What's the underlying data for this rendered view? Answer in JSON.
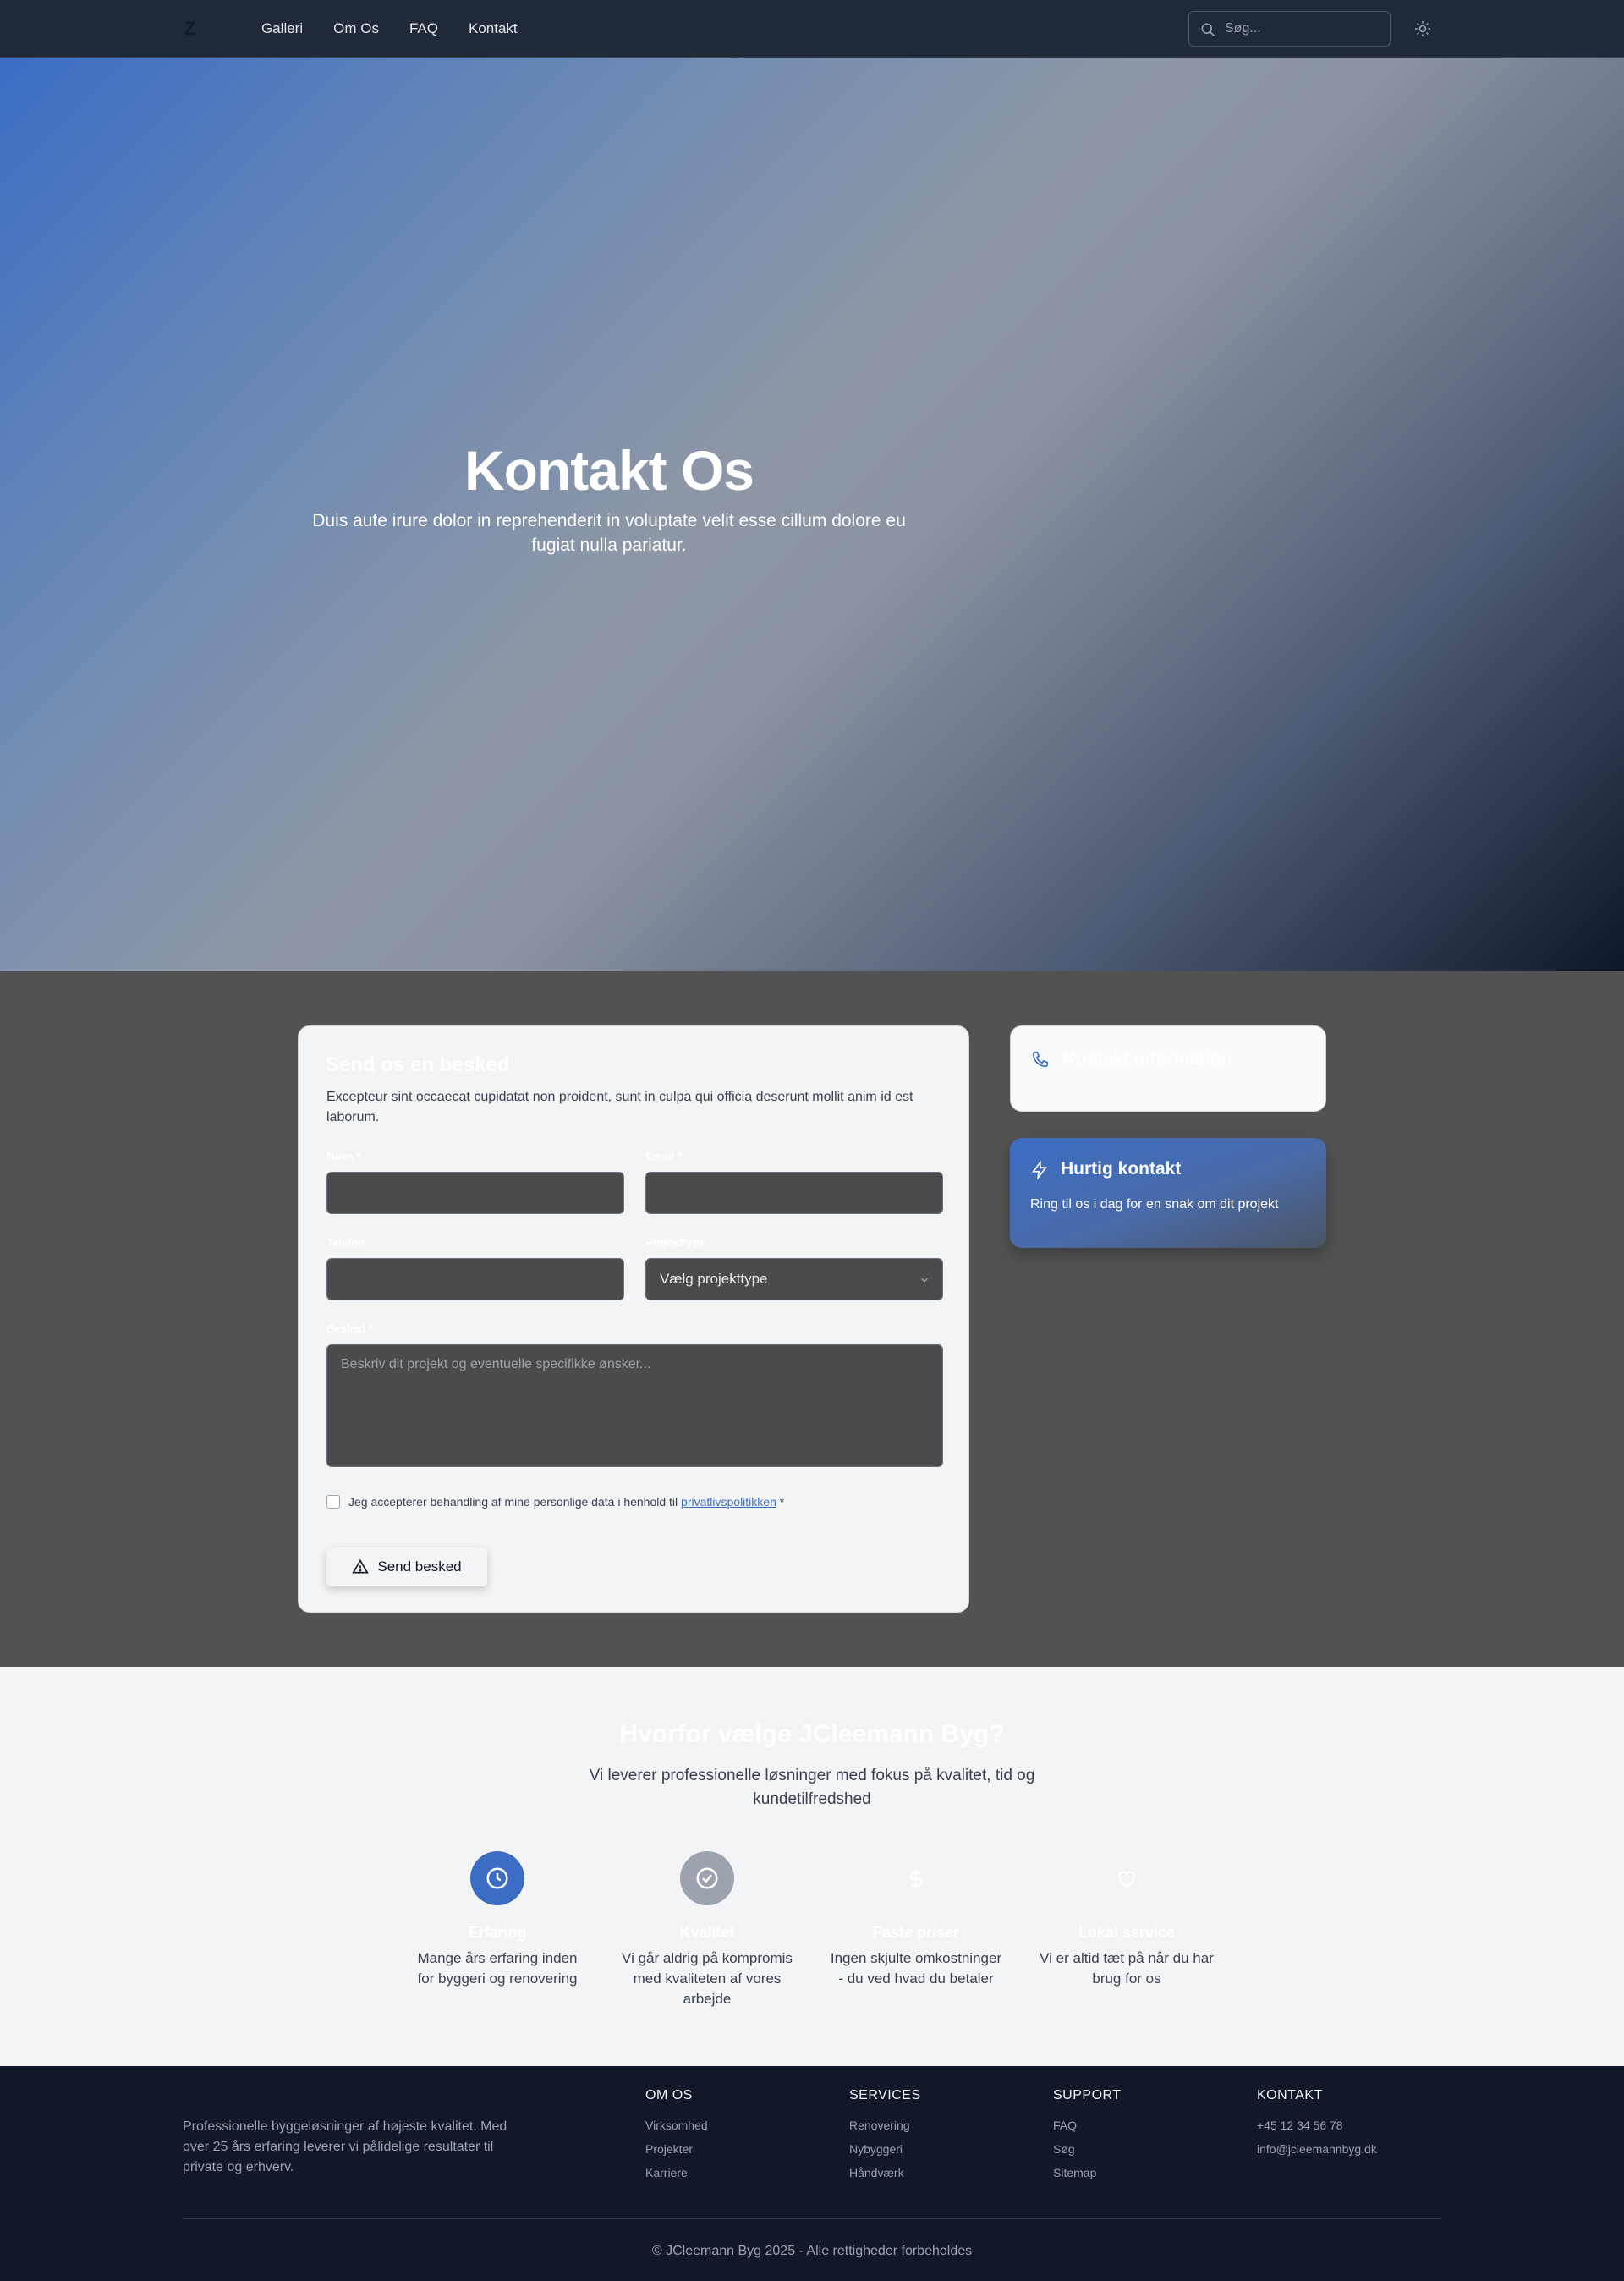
{
  "nav": {
    "logo": "Z",
    "links": [
      "Galleri",
      "Om Os",
      "FAQ",
      "Kontakt"
    ],
    "search_placeholder": "Søg...",
    "theme_icon": "sun-icon"
  },
  "hero": {
    "title": "Kontakt Os",
    "subtitle": "Duis aute irure dolor in reprehenderit in voluptate velit esse cillum dolore eu fugiat nulla pariatur."
  },
  "form": {
    "title": "Send os en besked",
    "description": "Excepteur sint occaecat cupidatat non proident, sunt in culpa qui officia deserunt mollit anim id est laborum.",
    "name_label": "Navn *",
    "email_label": "Email *",
    "phone_label": "Telefon",
    "project_label": "Projekttype",
    "project_value": "Vælg projekttype",
    "message_label": "Besked *",
    "message_placeholder": "Beskriv dit projekt og eventuelle specifikke ønsker...",
    "consent_text": "Jeg accepterer behandling af mine personlige data i henhold til",
    "consent_link": "privatlivspolitikken",
    "consent_required": "*",
    "submit_label": "Send besked"
  },
  "contact_info": {
    "title": "Kontakt information"
  },
  "quick_contact": {
    "title": "Hurtig kontakt",
    "text": "Ring til os i dag for en snak om dit projekt"
  },
  "why": {
    "title": "Hvorfor vælge JCleemann Byg?",
    "subtitle": "Vi leverer professionelle løsninger med fokus på kvalitet, tid og kundetilfredshed",
    "features": [
      {
        "title": "Erfaring",
        "desc": "Mange års erfaring inden for byggeri og renovering",
        "icon": "clock-icon",
        "color": "#3b6dc4"
      },
      {
        "title": "Kvalitet",
        "desc": "Vi går aldrig på kompromis med kvaliteten af vores arbejde",
        "icon": "check-circle-icon",
        "color": "#9ca3af"
      },
      {
        "title": "Faste priser",
        "desc": "Ingen skjulte omkostninger - du ved hvad du betaler",
        "icon": "dollar-icon",
        "color": "#f3f4f6"
      },
      {
        "title": "Lokal service",
        "desc": "Vi er altid tæt på når du har brug for os",
        "icon": "heart-icon",
        "color": "#f3f4f6"
      }
    ]
  },
  "footer": {
    "about": "Professionelle byggeløsninger af højeste kvalitet. Med over 25 års erfaring leverer vi pålidelige resultater til private og erhverv.",
    "columns": [
      {
        "title": "OM OS",
        "items": [
          "Virksomhed",
          "Projekter",
          "Karriere"
        ]
      },
      {
        "title": "SERVICES",
        "items": [
          "Renovering",
          "Nybyggeri",
          "Håndværk"
        ]
      },
      {
        "title": "SUPPORT",
        "items": [
          "FAQ",
          "Søg",
          "Sitemap"
        ]
      },
      {
        "title": "KONTAKT",
        "items": [
          "+45 12 34 56 78",
          "info@jcleemannbyg.dk"
        ]
      }
    ],
    "copyright": "© JCleemann Byg 2025 - Alle rettigheder forbeholdes"
  }
}
